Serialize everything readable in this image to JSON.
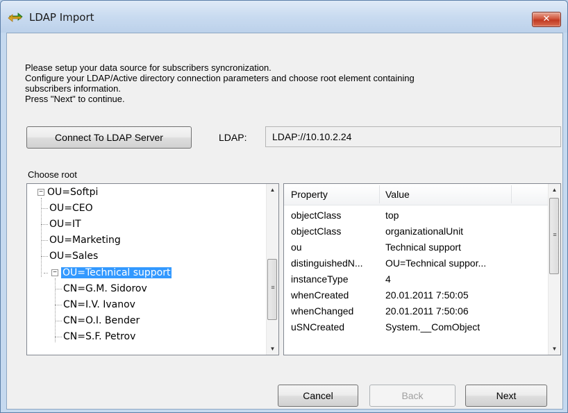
{
  "window": {
    "title": "LDAP Import",
    "close_label": "✕"
  },
  "instructions": {
    "line1": "Please setup your data source for subscribers syncronization.",
    "line2": "Configure your LDAP/Active directory connection parameters and choose root element containing",
    "line3": "subscribers information.",
    "line4": "Press \"Next\" to continue."
  },
  "connection": {
    "connect_button_label": "Connect To LDAP Server",
    "ldap_label": "LDAP:",
    "ldap_value": "LDAP://10.10.2.24"
  },
  "tree": {
    "label": "Choose root",
    "items": [
      {
        "label": "OU=Softpi"
      },
      {
        "label": "OU=CEO"
      },
      {
        "label": "OU=IT"
      },
      {
        "label": "OU=Marketing"
      },
      {
        "label": "OU=Sales"
      },
      {
        "label": "OU=Technical support"
      },
      {
        "label": "CN=G.M. Sidorov"
      },
      {
        "label": "CN=I.V. Ivanov"
      },
      {
        "label": "CN=O.I. Bender"
      },
      {
        "label": "CN=S.F. Petrov"
      }
    ]
  },
  "properties": {
    "columns": {
      "property": "Property",
      "value": "Value"
    },
    "rows": [
      {
        "property": "objectClass",
        "value": "top"
      },
      {
        "property": "objectClass",
        "value": "organizationalUnit"
      },
      {
        "property": "ou",
        "value": "Technical support"
      },
      {
        "property": "distinguishedN...",
        "value": "OU=Technical suppor..."
      },
      {
        "property": "instanceType",
        "value": "4"
      },
      {
        "property": "whenCreated",
        "value": "20.01.2011 7:50:05"
      },
      {
        "property": "whenChanged",
        "value": "20.01.2011 7:50:06"
      },
      {
        "property": "uSNCreated",
        "value": "System.__ComObject"
      }
    ]
  },
  "footer": {
    "cancel_label": "Cancel",
    "back_label": "Back",
    "next_label": "Next"
  },
  "colors": {
    "selection": "#3399ff",
    "titlebar": "#c9dbf0",
    "close_button": "#c13a22"
  }
}
